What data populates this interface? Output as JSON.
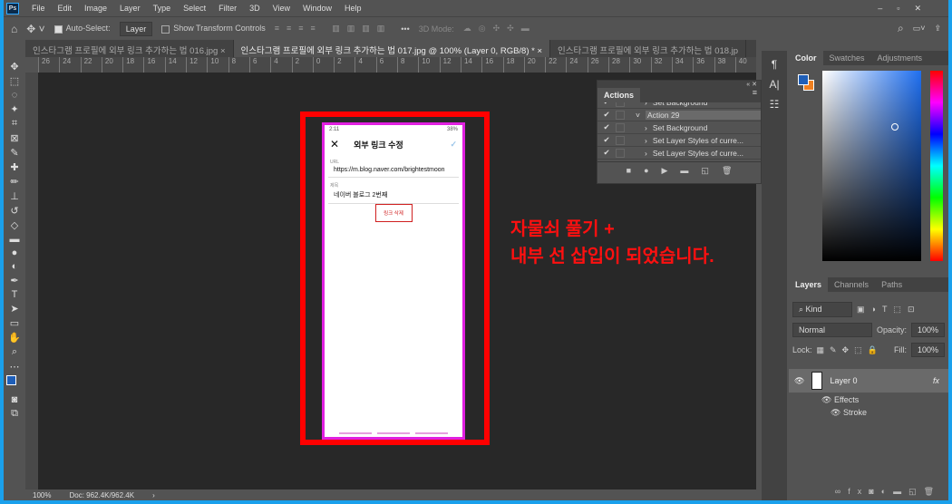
{
  "menu": [
    "File",
    "Edit",
    "Image",
    "Layer",
    "Type",
    "Select",
    "Filter",
    "3D",
    "View",
    "Window",
    "Help"
  ],
  "options": {
    "auto_select": "Auto-Select:",
    "layer_select": "Layer",
    "show_transform": "Show Transform Controls",
    "mode_3d": "3D Mode:"
  },
  "tabs": [
    "인스타그램 프로필에 외부 링크 추가하는 법 016.jpg ×",
    "인스타그램 프로필에 외부 링크 추가하는 법 017.jpg @ 100% (Layer 0, RGB/8) * ×",
    "인스타그램 프로필에 외부 링크 추가하는 법 018.jp"
  ],
  "ruler": [
    "26",
    "24",
    "22",
    "20",
    "18",
    "16",
    "14",
    "12",
    "10",
    "8",
    "6",
    "4",
    "2",
    "0",
    "2",
    "4",
    "6",
    "8",
    "10",
    "12",
    "14",
    "16",
    "18",
    "20",
    "22",
    "24",
    "26",
    "28",
    "30",
    "32",
    "34",
    "36",
    "38",
    "40"
  ],
  "status": {
    "zoom": "100%",
    "doc": "Doc: 962.4K/962.4K"
  },
  "phone": {
    "time": "2:11",
    "battery": "38%",
    "title": "외부 링크 수정",
    "url_label": "URL",
    "url": "https://m.blog.naver.com/brightestmoon",
    "name_label": "제목",
    "name": "네이버 블로그 2번째",
    "delete": "링크 삭제"
  },
  "note": {
    "line1": "자물쇠 풀기 +",
    "line2": "내부 선 삽입이 되었습니다."
  },
  "actions": {
    "title": "Actions",
    "items": [
      "Set Background",
      "Action 29",
      "Set Background",
      "Set Layer Styles of curre...",
      "Set Layer Styles of curre..."
    ]
  },
  "color_panel": {
    "tabs": [
      "Color",
      "Swatches",
      "Adjustments"
    ],
    "fg": "#1f5fb8",
    "bg": "#f08020"
  },
  "layers_panel": {
    "tabs": [
      "Layers",
      "Channels",
      "Paths"
    ],
    "kind": "Kind",
    "blend": "Normal",
    "opacity_label": "Opacity:",
    "opacity": "100%",
    "lock_label": "Lock:",
    "fill_label": "Fill:",
    "fill": "100%",
    "layer": "Layer 0",
    "fx": "fx",
    "effects": "Effects",
    "stroke": "Stroke"
  }
}
